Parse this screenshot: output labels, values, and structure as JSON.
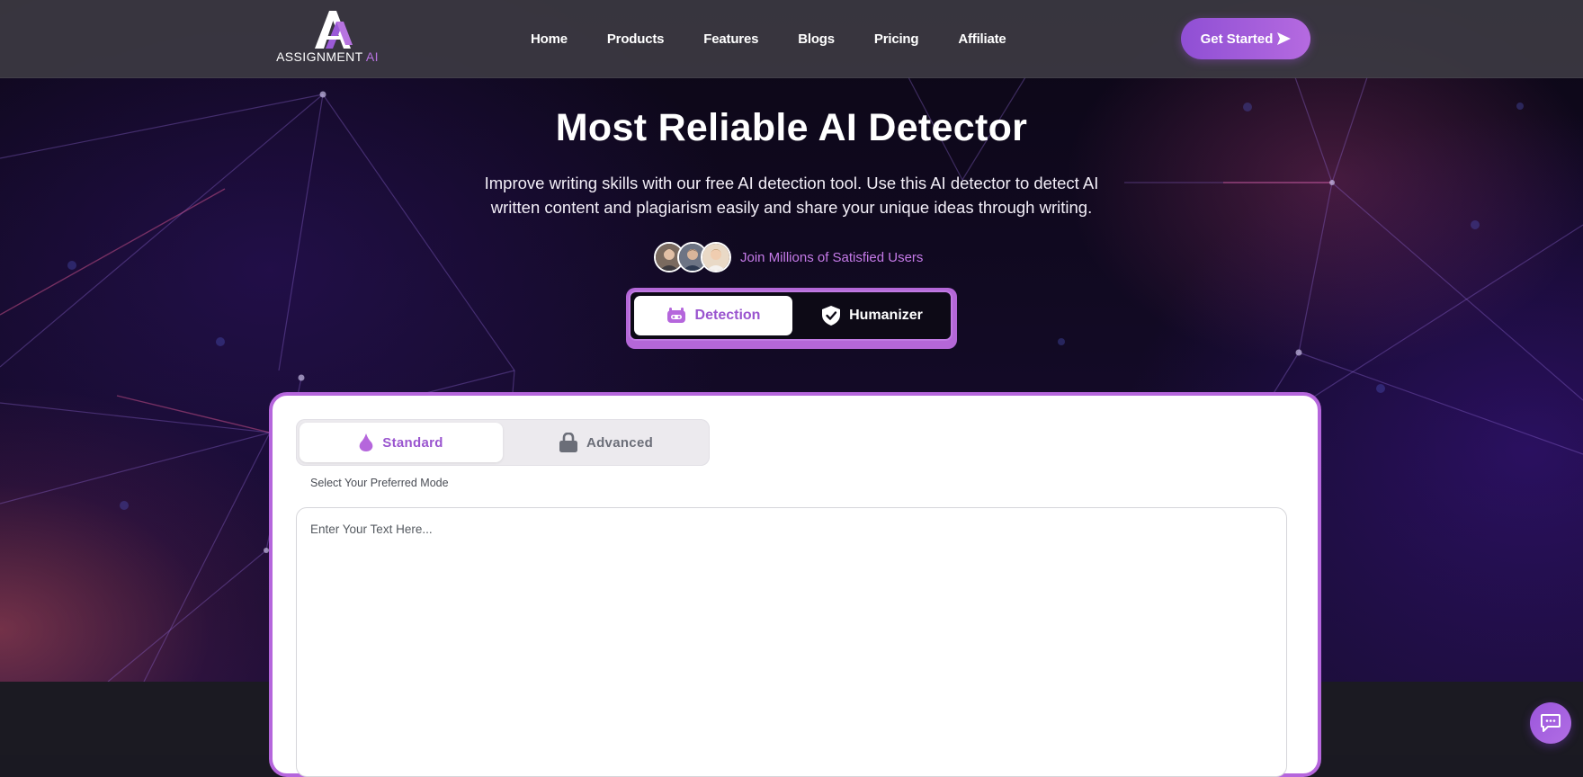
{
  "header": {
    "logo": {
      "brand": "ASSIGNMENT",
      "accent": "AI"
    },
    "nav": [
      "Home",
      "Products",
      "Features",
      "Blogs",
      "Pricing",
      "Affiliate"
    ],
    "cta_label": "Get Started",
    "cta_icon": "send-arrow-icon"
  },
  "hero": {
    "title": "Most Reliable AI Detector",
    "subtitle": "Improve writing skills with our free AI detection tool. Use this AI detector to detect AI written content and plagiarism easily and share your unique ideas through writing.",
    "users_label": "Join Millions of Satisfied Users",
    "avatar_count": 3
  },
  "mode_switch": {
    "options": [
      {
        "label": "Detection",
        "icon": "robot-icon",
        "active": true
      },
      {
        "label": "Humanizer",
        "icon": "shield-check-icon",
        "active": false
      }
    ]
  },
  "card": {
    "modes": [
      {
        "label": "Standard",
        "icon": "drop-icon",
        "active": true
      },
      {
        "label": "Advanced",
        "icon": "lock-icon",
        "active": false
      }
    ],
    "mode_caption": "Select Your Preferred Mode",
    "text_placeholder": "Enter Your Text Here...",
    "text_value": ""
  },
  "chat_widget": {
    "icon": "chat-icon"
  },
  "colors": {
    "accent": "#b566dc",
    "accent_dark": "#9a55cf",
    "header_bg": "#3c3a42",
    "hero_bg": "#0c0716"
  }
}
